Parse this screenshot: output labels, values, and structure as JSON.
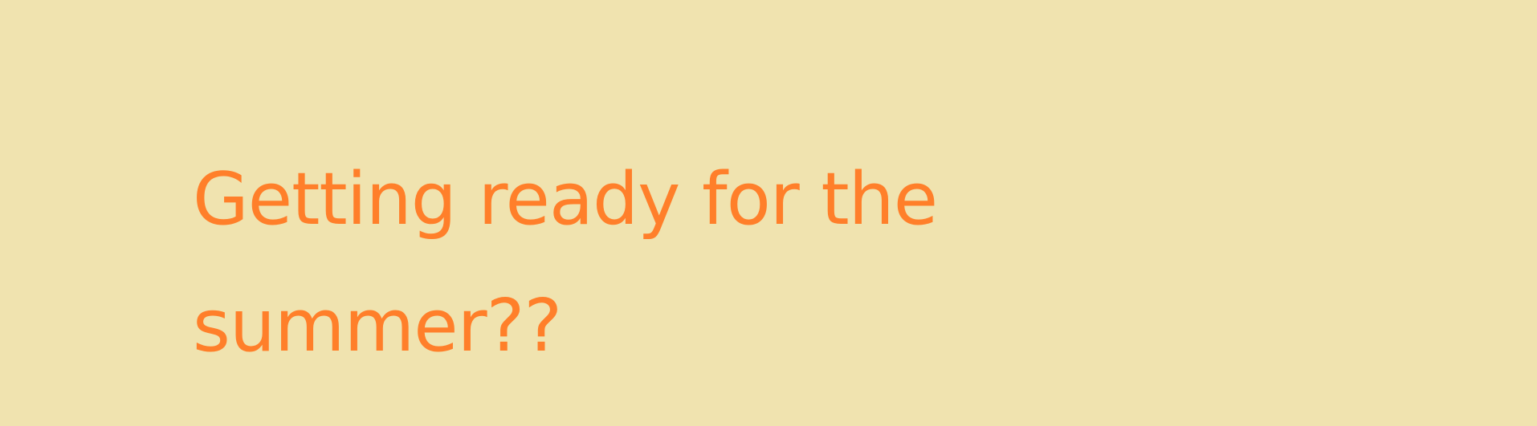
{
  "banner": {
    "background_color": "#F0E3AF",
    "text_color": "#FF7F2A",
    "headline_line1": "Getting ready for the",
    "headline_line2": "summer??"
  }
}
